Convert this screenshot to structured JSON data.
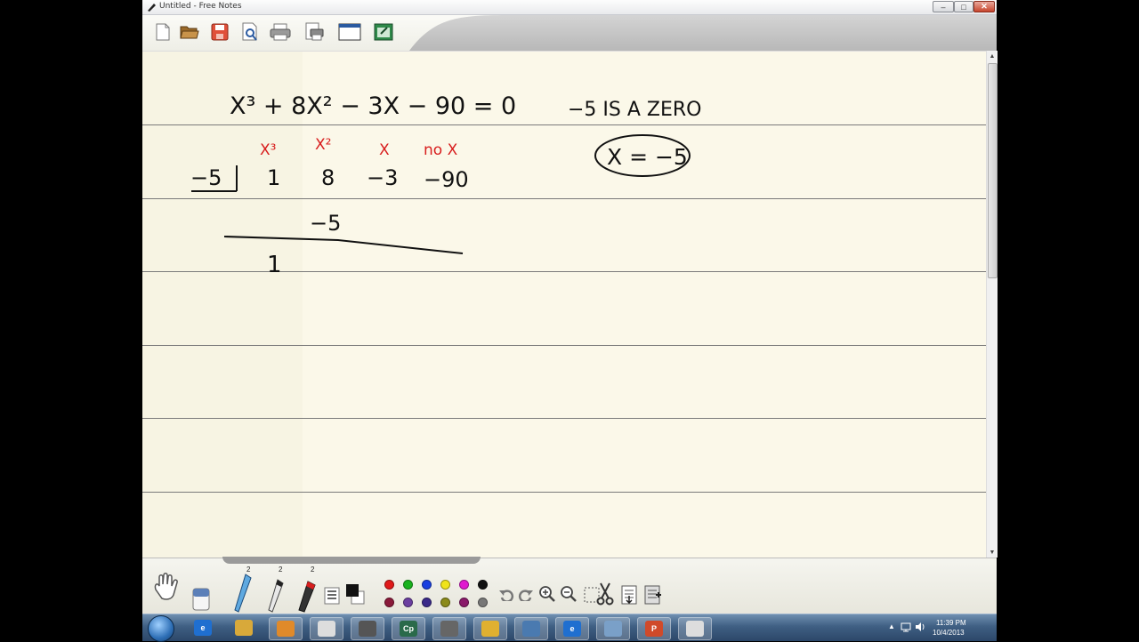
{
  "window": {
    "title": "Untitled - Free Notes",
    "min_glyph": "–",
    "max_glyph": "□",
    "close_glyph": "✕"
  },
  "toolbar": {
    "buttons": [
      {
        "name": "new-page-icon"
      },
      {
        "name": "open-folder-icon"
      },
      {
        "name": "save-icon"
      },
      {
        "name": "print-preview-icon"
      },
      {
        "name": "print-icon"
      },
      {
        "name": "page-setup-icon"
      },
      {
        "name": "window-icon"
      },
      {
        "name": "export-icon"
      }
    ]
  },
  "notes": {
    "equation": "X³ + 8X² − 3X − 90 = 0",
    "zero_statement": "−5 IS A ZERO",
    "root_boxed": "X = −5",
    "column_headers": [
      "X³",
      "X²",
      "X",
      "no X"
    ],
    "divisor": "−5",
    "coefficients": [
      "1",
      "8",
      "−3",
      "−90"
    ],
    "partial_product": "−5",
    "carried_down": "1",
    "ink_black": "#111111",
    "ink_red": "#d81e1e"
  },
  "palette": {
    "pen_widths": [
      "2",
      "2",
      "2"
    ],
    "colors": [
      "#e01a1a",
      "#19b21e",
      "#1a3fe0",
      "#f0e41a",
      "#e01ad0",
      "#111111",
      "#8a1a3a",
      "#6b3fa0",
      "#3a2a8a",
      "#8a8a1a",
      "#8a1a6a",
      "#777777"
    ],
    "tools": [
      {
        "name": "hand-icon"
      },
      {
        "name": "eraser-icon"
      },
      {
        "name": "blue-pen-icon"
      },
      {
        "name": "pencil-icon"
      },
      {
        "name": "red-marker-icon"
      },
      {
        "name": "line-style-icon"
      },
      {
        "name": "fill-icon"
      },
      {
        "name": "undo-icon"
      },
      {
        "name": "redo-icon"
      },
      {
        "name": "zoom-in-icon"
      },
      {
        "name": "zoom-out-icon"
      },
      {
        "name": "select-icon"
      },
      {
        "name": "cut-icon"
      },
      {
        "name": "insert-page-icon"
      },
      {
        "name": "add-page-icon"
      }
    ]
  },
  "taskbar": {
    "apps": [
      {
        "name": "ie-icon",
        "label": "e"
      },
      {
        "name": "explorer-icon",
        "label": ""
      },
      {
        "name": "media-player-icon",
        "label": ""
      },
      {
        "name": "free-notes-task-icon",
        "label": ""
      },
      {
        "name": "camtasia-recorder-icon",
        "label": ""
      },
      {
        "name": "captivate-icon",
        "label": "Cp"
      },
      {
        "name": "app-task-icon",
        "label": ""
      },
      {
        "name": "chrome-icon",
        "label": ""
      },
      {
        "name": "network-app-icon",
        "label": ""
      },
      {
        "name": "ie-icon-2",
        "label": "e"
      },
      {
        "name": "notepad-icon",
        "label": ""
      },
      {
        "name": "powerpoint-icon",
        "label": "P"
      },
      {
        "name": "free-notes-icon-2",
        "label": ""
      }
    ],
    "clock_time": "11:39 PM",
    "clock_date": "10/4/2013"
  }
}
